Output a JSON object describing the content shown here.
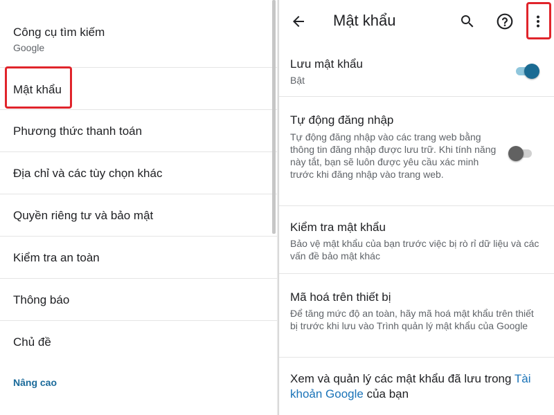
{
  "left_panel": {
    "items": [
      {
        "label": "Công cụ tìm kiếm",
        "subtitle": "Google"
      },
      {
        "label": "Mật khẩu"
      },
      {
        "label": "Phương thức thanh toán"
      },
      {
        "label": "Địa chỉ và các tùy chọn khác"
      },
      {
        "label": "Quyền riêng tư và bảo mật"
      },
      {
        "label": "Kiểm tra an toàn"
      },
      {
        "label": "Thông báo"
      },
      {
        "label": "Chủ đề"
      }
    ],
    "advanced_label": "Nâng cao"
  },
  "right_panel": {
    "title": "Mật khẩu",
    "icons": {
      "back": "back-arrow-icon",
      "search": "search-icon",
      "help": "help-icon",
      "more": "more-vert-icon"
    },
    "save_passwords": {
      "title": "Lưu mật khẩu",
      "status": "Bật",
      "toggle_on": true
    },
    "auto_signin": {
      "title": "Tự động đăng nhập",
      "description": "Tự động đăng nhập vào các trang web bằng thông tin đăng nhập được lưu trữ. Khi tính năng này tắt, bạn sẽ luôn được yêu cầu xác minh trước khi đăng nhập vào trang web.",
      "toggle_on": false
    },
    "check_passwords": {
      "title": "Kiểm tra mật khẩu",
      "description": "Bảo vệ mật khẩu của bạn trước việc bị rò rỉ dữ liệu và các vấn đề bảo mật khác"
    },
    "on_device_encryption": {
      "title": "Mã hoá trên thiết bị",
      "description": "Để tăng mức độ an toàn, hãy mã hoá mật khẩu trên thiết bị trước khi lưu vào Trình quản lý mật khẩu của Google"
    },
    "view_manage": {
      "text_prefix": "Xem và quản lý các mật khẩu đã lưu trong ",
      "link_text": "Tài khoản Google",
      "text_suffix": " của bạn"
    }
  },
  "colors": {
    "accent": "#1b6b93",
    "highlight": "#e0242b",
    "link": "#1a73b8"
  }
}
